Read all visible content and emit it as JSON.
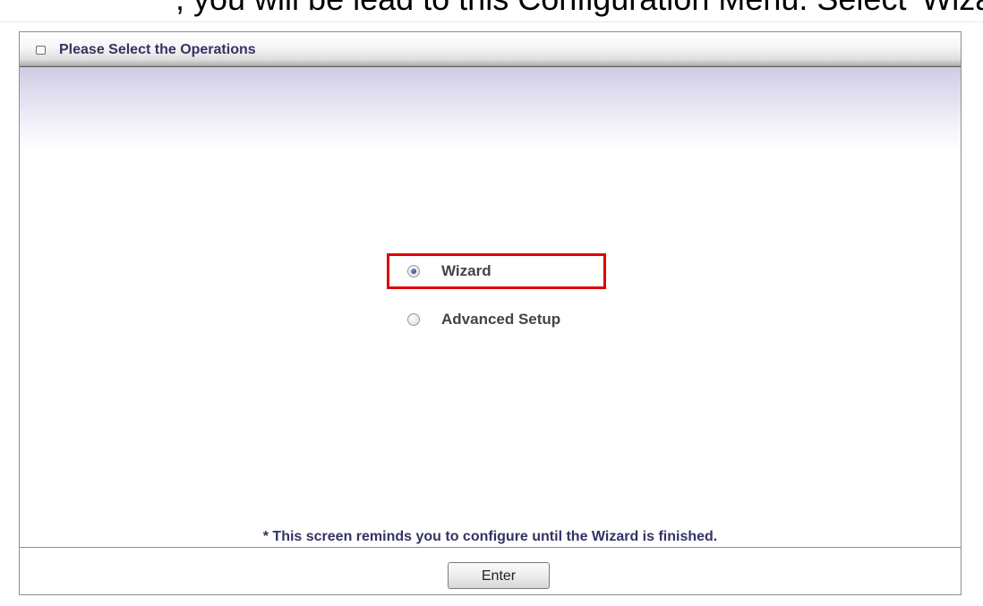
{
  "top_caption": ", you will be lead to this Configuration Menu. Select 'Wizard' and press 'Enter' so you",
  "panel": {
    "title": "Please Select the Operations",
    "title_icon": "square-bullet-icon"
  },
  "options": [
    {
      "label": "Wizard",
      "checked": true
    },
    {
      "label": "Advanced Setup",
      "checked": false
    }
  ],
  "note": "* This screen reminds you to configure until the Wizard is finished.",
  "enter_label": "Enter",
  "colors": {
    "title_text": "#333366",
    "highlight_box": "#e00000",
    "band": "#cfcbe6"
  }
}
